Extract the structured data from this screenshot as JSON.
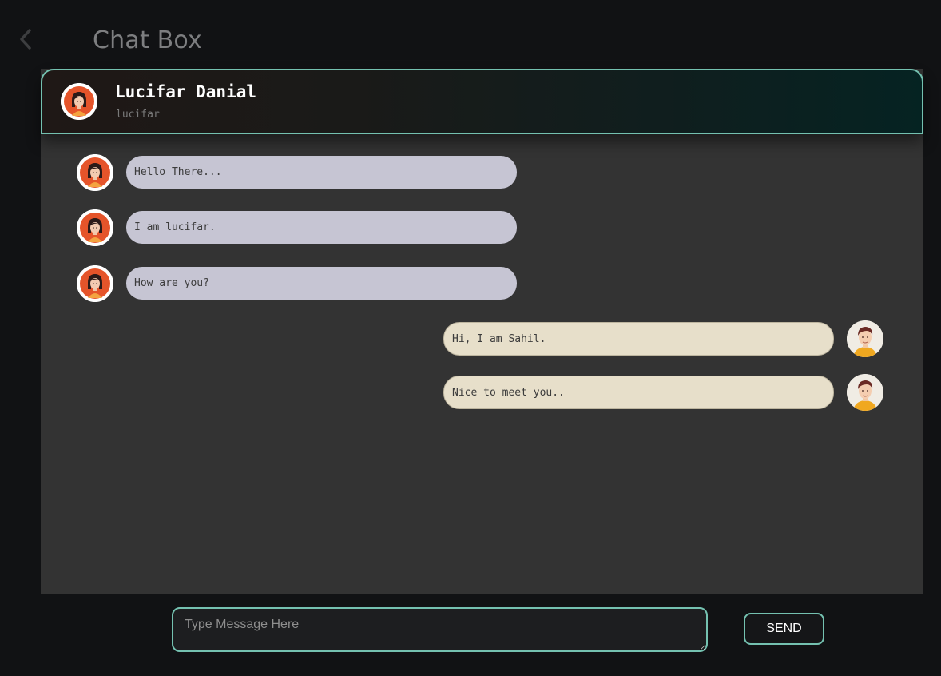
{
  "page": {
    "title": "Chat Box",
    "back_icon": "chevron-left-icon"
  },
  "contact": {
    "name": "Lucifar Danial",
    "handle": "lucifar",
    "avatar_icon": "female-avatar-icon"
  },
  "messages": [
    {
      "direction": "incoming",
      "text": "Hello There...",
      "avatar_icon": "female-avatar-icon"
    },
    {
      "direction": "incoming",
      "text": "I am lucifar.",
      "avatar_icon": "female-avatar-icon"
    },
    {
      "direction": "incoming",
      "text": "How are you?",
      "avatar_icon": "female-avatar-icon"
    },
    {
      "direction": "outgoing",
      "text": "Hi, I am Sahil.",
      "avatar_icon": "male-avatar-icon"
    },
    {
      "direction": "outgoing",
      "text": "Nice to meet you..",
      "avatar_icon": "male-avatar-icon"
    }
  ],
  "composer": {
    "placeholder": "Type Message Here",
    "value": "",
    "send_label": "SEND"
  },
  "colors": {
    "accent": "#74c1b0",
    "background": "#111214",
    "chat_background": "#333333",
    "incoming_bubble": "#c6c5d3",
    "outgoing_bubble": "#e7dfca"
  }
}
